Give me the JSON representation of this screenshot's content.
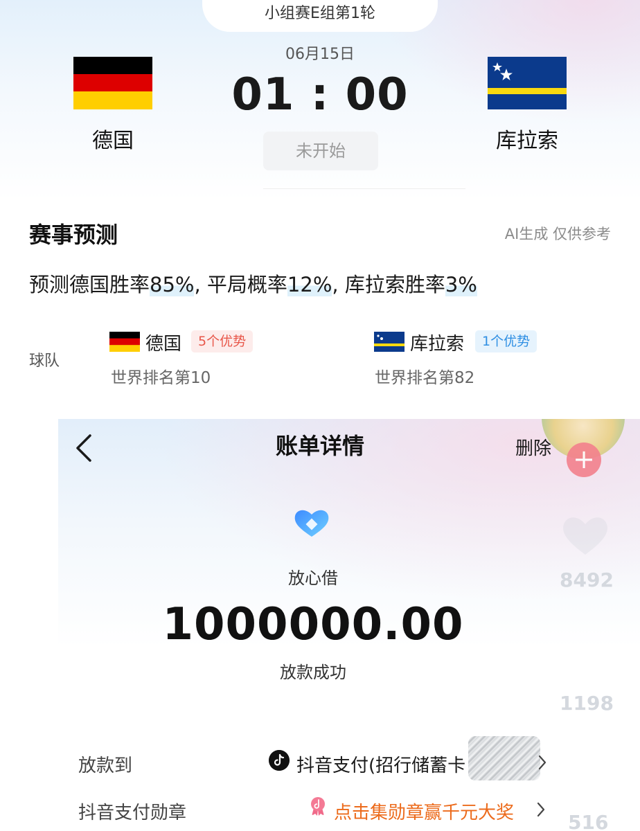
{
  "match": {
    "round": "小组赛E组第1轮",
    "date": "06月15日",
    "time": "01 : 00",
    "status": "未开始",
    "home_team": "德国",
    "away_team": "库拉索"
  },
  "prediction": {
    "title": "赛事预测",
    "note": "AI生成 仅供参考",
    "text_parts": [
      "预测德国胜率",
      "85%",
      ", 平局概率",
      "12%",
      ", 库拉索胜率",
      "3%"
    ],
    "row_label": "球队",
    "home": {
      "name": "德国",
      "advantage": "5个优势",
      "rank": "世界排名第10"
    },
    "away": {
      "name": "库拉索",
      "advantage": "1个优势",
      "rank": "世界排名第82"
    }
  },
  "bill": {
    "title": "账单详情",
    "delete_label": "删除",
    "brand_name": "放心借",
    "amount": "1000000.00",
    "status": "放款成功",
    "rows": [
      {
        "label": "放款到",
        "value": "抖音支付(招行储蓄卡"
      },
      {
        "label": "抖音支付勋章",
        "value": "点击集勋章赢千元大奖"
      }
    ],
    "side_counts": [
      "8492",
      "1198",
      "516"
    ]
  },
  "colors": {
    "advantage_home": "#e8574a",
    "advantage_away": "#2f8fe3",
    "medal_link": "#ec6b1c",
    "highlight": "#dff1fb"
  },
  "icons": [
    "germany-flag",
    "curacao-flag",
    "back-chevron-icon",
    "brand-logo-icon",
    "douyin-icon",
    "medal-icon",
    "chevron-right-icon",
    "plus-icon",
    "heart-icon",
    "avatar"
  ]
}
